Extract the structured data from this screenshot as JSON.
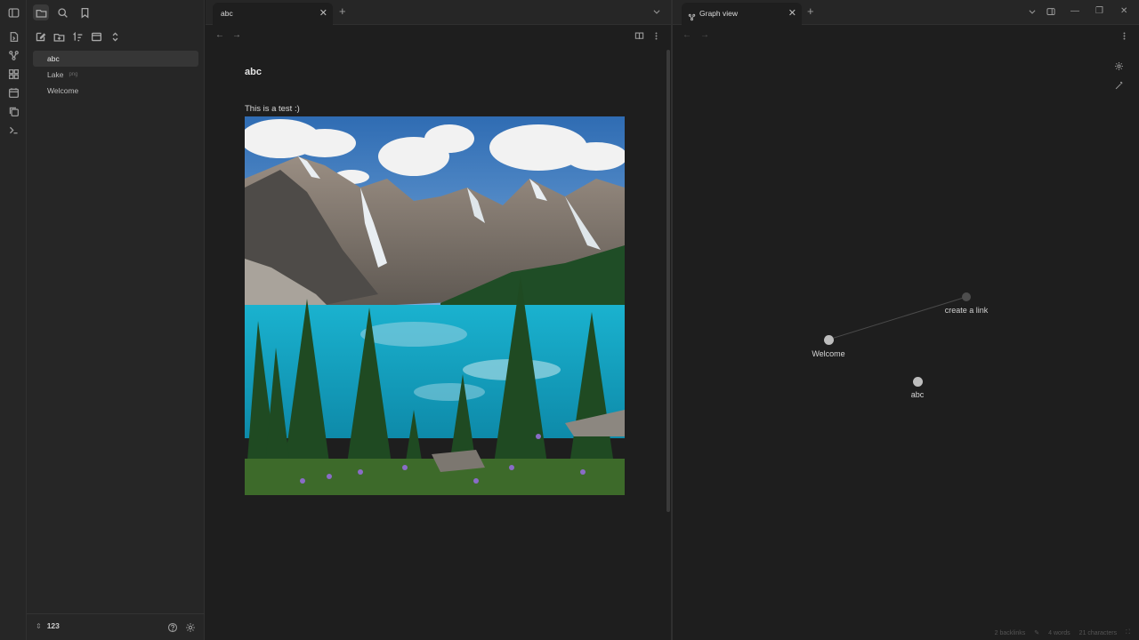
{
  "sidebar": {
    "tree": [
      {
        "label": "abc",
        "ext": "",
        "active": true
      },
      {
        "label": "Lake",
        "ext": "png",
        "active": false
      },
      {
        "label": "Welcome",
        "ext": "",
        "active": false
      }
    ],
    "vault_name": "123"
  },
  "left_pane": {
    "tab_label": "abc",
    "note_title": "abc",
    "note_text": "This is a test :)"
  },
  "right_pane": {
    "tab_label": "Graph view",
    "nodes": [
      {
        "label": "create a link",
        "color": "#4d4d4d"
      },
      {
        "label": "Welcome",
        "color": "#bdbdbd"
      },
      {
        "label": "abc",
        "color": "#bdbdbd"
      }
    ]
  },
  "status": {
    "backlinks": "2 backlinks",
    "words": "4 words",
    "characters": "21 characters"
  },
  "colors": {
    "background": "#1e1e1e",
    "sidebar": "#262626",
    "accent_text": "#dadada"
  },
  "icons": [
    "sidebar-toggle-icon",
    "folder-icon",
    "search-icon",
    "bookmark-icon",
    "new-note-icon",
    "new-folder-icon",
    "sort-icon",
    "collapse-icon",
    "expand-icon",
    "help-icon",
    "settings-icon",
    "graph-icon",
    "book-icon",
    "more-icon",
    "magic-wand-icon"
  ]
}
